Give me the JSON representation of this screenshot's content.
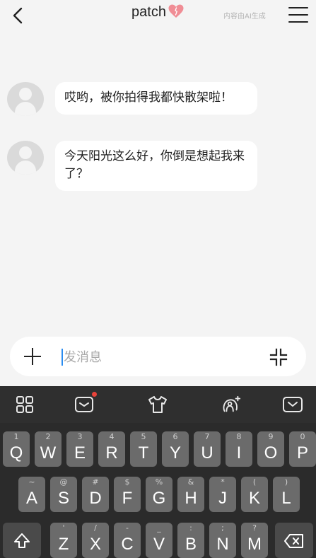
{
  "header": {
    "title": "patch",
    "ai_note": "内容由AI生成"
  },
  "messages": [
    {
      "text": "哎哟，被你拍得我都快散架啦！"
    },
    {
      "text": "今天阳光这么好，你倒是想起我来了？"
    }
  ],
  "composer": {
    "placeholder": "发消息",
    "value": ""
  },
  "keyboard": {
    "toolbar": [
      "grid-icon",
      "inbox-icon",
      "tshirt-icon",
      "avatar-sparkle-icon",
      "hide-keyboard-icon"
    ],
    "row1": [
      {
        "key": "Q",
        "sub": "1"
      },
      {
        "key": "W",
        "sub": "2"
      },
      {
        "key": "E",
        "sub": "3"
      },
      {
        "key": "R",
        "sub": "4"
      },
      {
        "key": "T",
        "sub": "5"
      },
      {
        "key": "Y",
        "sub": "6"
      },
      {
        "key": "U",
        "sub": "7"
      },
      {
        "key": "I",
        "sub": "8"
      },
      {
        "key": "O",
        "sub": "9"
      },
      {
        "key": "P",
        "sub": "0"
      }
    ],
    "row2": [
      {
        "key": "A",
        "sub": "~"
      },
      {
        "key": "S",
        "sub": "@"
      },
      {
        "key": "D",
        "sub": "#"
      },
      {
        "key": "F",
        "sub": "$"
      },
      {
        "key": "G",
        "sub": "%"
      },
      {
        "key": "H",
        "sub": "&"
      },
      {
        "key": "J",
        "sub": "*"
      },
      {
        "key": "K",
        "sub": "("
      },
      {
        "key": "L",
        "sub": ")"
      }
    ],
    "row3": [
      {
        "key": "Z",
        "sub": "'"
      },
      {
        "key": "X",
        "sub": "/"
      },
      {
        "key": "C",
        "sub": "-"
      },
      {
        "key": "V",
        "sub": "_"
      },
      {
        "key": "B",
        "sub": ":"
      },
      {
        "key": "N",
        "sub": ";"
      },
      {
        "key": "M",
        "sub": "?"
      }
    ]
  }
}
